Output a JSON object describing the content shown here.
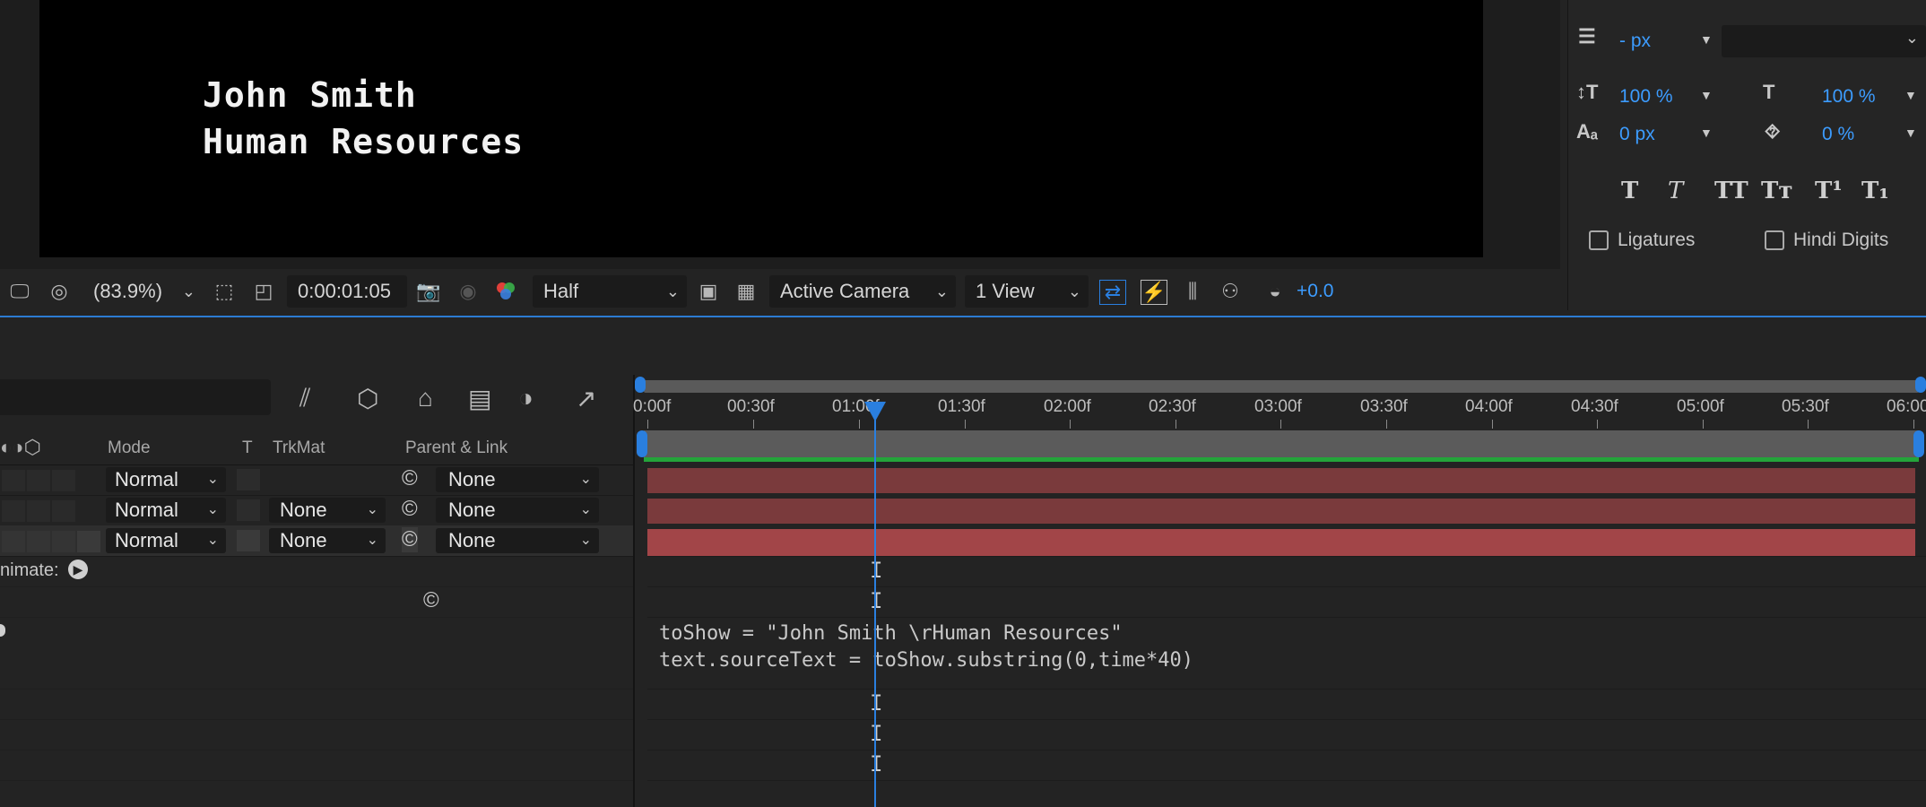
{
  "composition": {
    "line1": "John Smith",
    "line2": "Human Resources"
  },
  "viewer_toolbar": {
    "magnification": "(83.9%)",
    "timecode": "0:00:01:05",
    "resolution": "Half",
    "camera": "Active Camera",
    "views": "1 View",
    "exposure": "+0.0"
  },
  "character": {
    "leading_value": "- px",
    "vscale": "100 %",
    "hscale": "100 %",
    "baseline": "0 px",
    "tsume": "0 %",
    "styles": [
      "T",
      "T",
      "TT",
      "Tт",
      "T¹",
      "T₁"
    ],
    "ligatures_label": "Ligatures",
    "hindi_digits_label": "Hindi Digits"
  },
  "timeline": {
    "columns": {
      "mode": "Mode",
      "t": "T",
      "trkmat": "TrkMat",
      "parent": "Parent & Link"
    },
    "layers": [
      {
        "mode": "Normal",
        "trkmat": "",
        "parent": "None"
      },
      {
        "mode": "Normal",
        "trkmat": "None",
        "parent": "None"
      },
      {
        "mode": "Normal",
        "trkmat": "None",
        "parent": "None"
      }
    ],
    "animate_label": "nimate:",
    "ruler": [
      "0:00f",
      "00:30f",
      "01:00f",
      "01:30f",
      "02:00f",
      "02:30f",
      "03:00f",
      "03:30f",
      "04:00f",
      "04:30f",
      "05:00f",
      "05:30f",
      "06:00"
    ],
    "expression": {
      "line1": "toShow = \"John Smith \\rHuman Resources\"",
      "line2": "text.sourceText = toShow.substring(0,time*40)"
    }
  },
  "colors": {
    "accent": "#2a7fdf",
    "value_blue": "#3c9cff",
    "track": "#7a3a3c",
    "work_area_green": "#24a43a"
  }
}
